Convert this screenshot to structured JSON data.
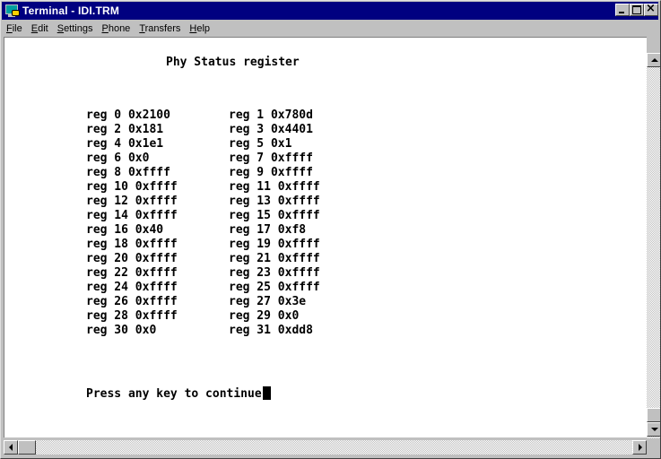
{
  "window": {
    "title": "Terminal - IDI.TRM"
  },
  "title_buttons": {
    "minimize_icon": "minimize-icon",
    "maximize_icon": "maximize-icon",
    "close_icon": "close-icon",
    "close_glyph": "×"
  },
  "menu": {
    "items": [
      {
        "label_u": "F",
        "label_rest": "ile"
      },
      {
        "label_u": "E",
        "label_rest": "dit"
      },
      {
        "label_u": "S",
        "label_rest": "ettings"
      },
      {
        "label_u": "P",
        "label_rest": "hone"
      },
      {
        "label_u": "T",
        "label_rest": "ransfers"
      },
      {
        "label_u": "H",
        "label_rest": "elp"
      }
    ]
  },
  "terminal": {
    "heading": "Phy Status register",
    "registers_left": [
      "reg 0 0x2100",
      "reg 2 0x181",
      "reg 4 0x1e1",
      "reg 6 0x0",
      "reg 8 0xffff",
      "reg 10 0xffff",
      "reg 12 0xffff",
      "reg 14 0xffff",
      "reg 16 0x40",
      "reg 18 0xffff",
      "reg 20 0xffff",
      "reg 22 0xffff",
      "reg 24 0xffff",
      "reg 26 0xffff",
      "reg 28 0xffff",
      "reg 30 0x0"
    ],
    "registers_right": [
      "reg 1 0x780d",
      "reg 3 0x4401",
      "reg 5 0x1",
      "reg 7 0xffff",
      "reg 9 0xffff",
      "reg 11 0xffff",
      "reg 13 0xffff",
      "reg 15 0xffff",
      "reg 17 0xf8",
      "reg 19 0xffff",
      "reg 21 0xffff",
      "reg 23 0xffff",
      "reg 25 0xffff",
      "reg 27 0x3e",
      "reg 29 0x0",
      "reg 31 0xdd8"
    ],
    "prompt": "Press any key to continue"
  }
}
